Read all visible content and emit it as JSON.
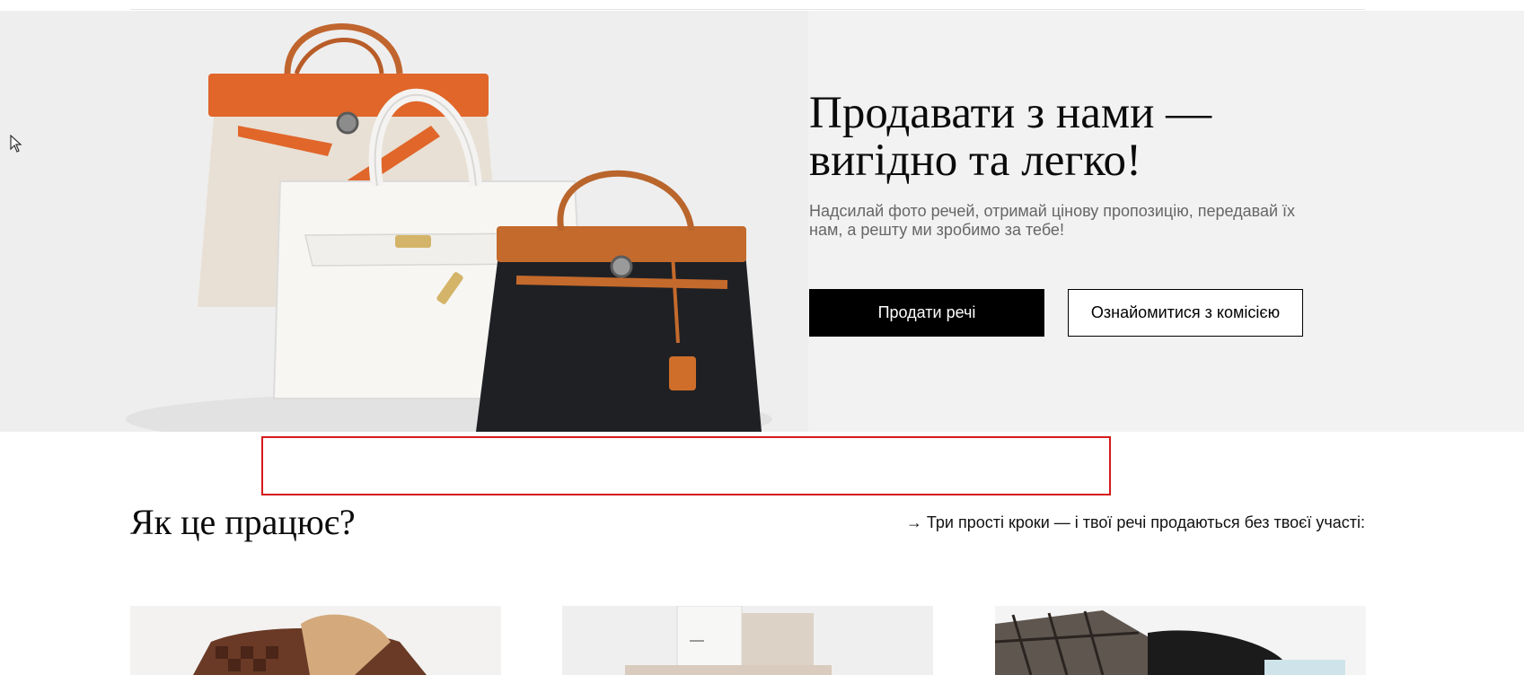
{
  "hero": {
    "title": "Продавати з нами — вигідно та легко!",
    "subtitle": "Надсилай фото речей, отримай цінову пропозицію, передавай їх нам, а решту ми зробимо за тебе!",
    "primary_button": "Продати речі",
    "secondary_button": "Ознайомитися з комісією",
    "image_icon": "handbags-photo"
  },
  "how": {
    "title": "Як це працює?",
    "note": "→ Три прості кроки — і твої речі продаються без твоєї участі:"
  },
  "steps": [
    {
      "image_icon": "bag-with-gloves-photo"
    },
    {
      "image_icon": "parcel-boxes-photo"
    },
    {
      "image_icon": "hand-with-card-photo"
    }
  ],
  "colors": {
    "hero_background": "#f2f2f2",
    "primary_button_bg": "#000000",
    "highlight_border": "#d61a1a",
    "subtitle_text": "#666666"
  }
}
